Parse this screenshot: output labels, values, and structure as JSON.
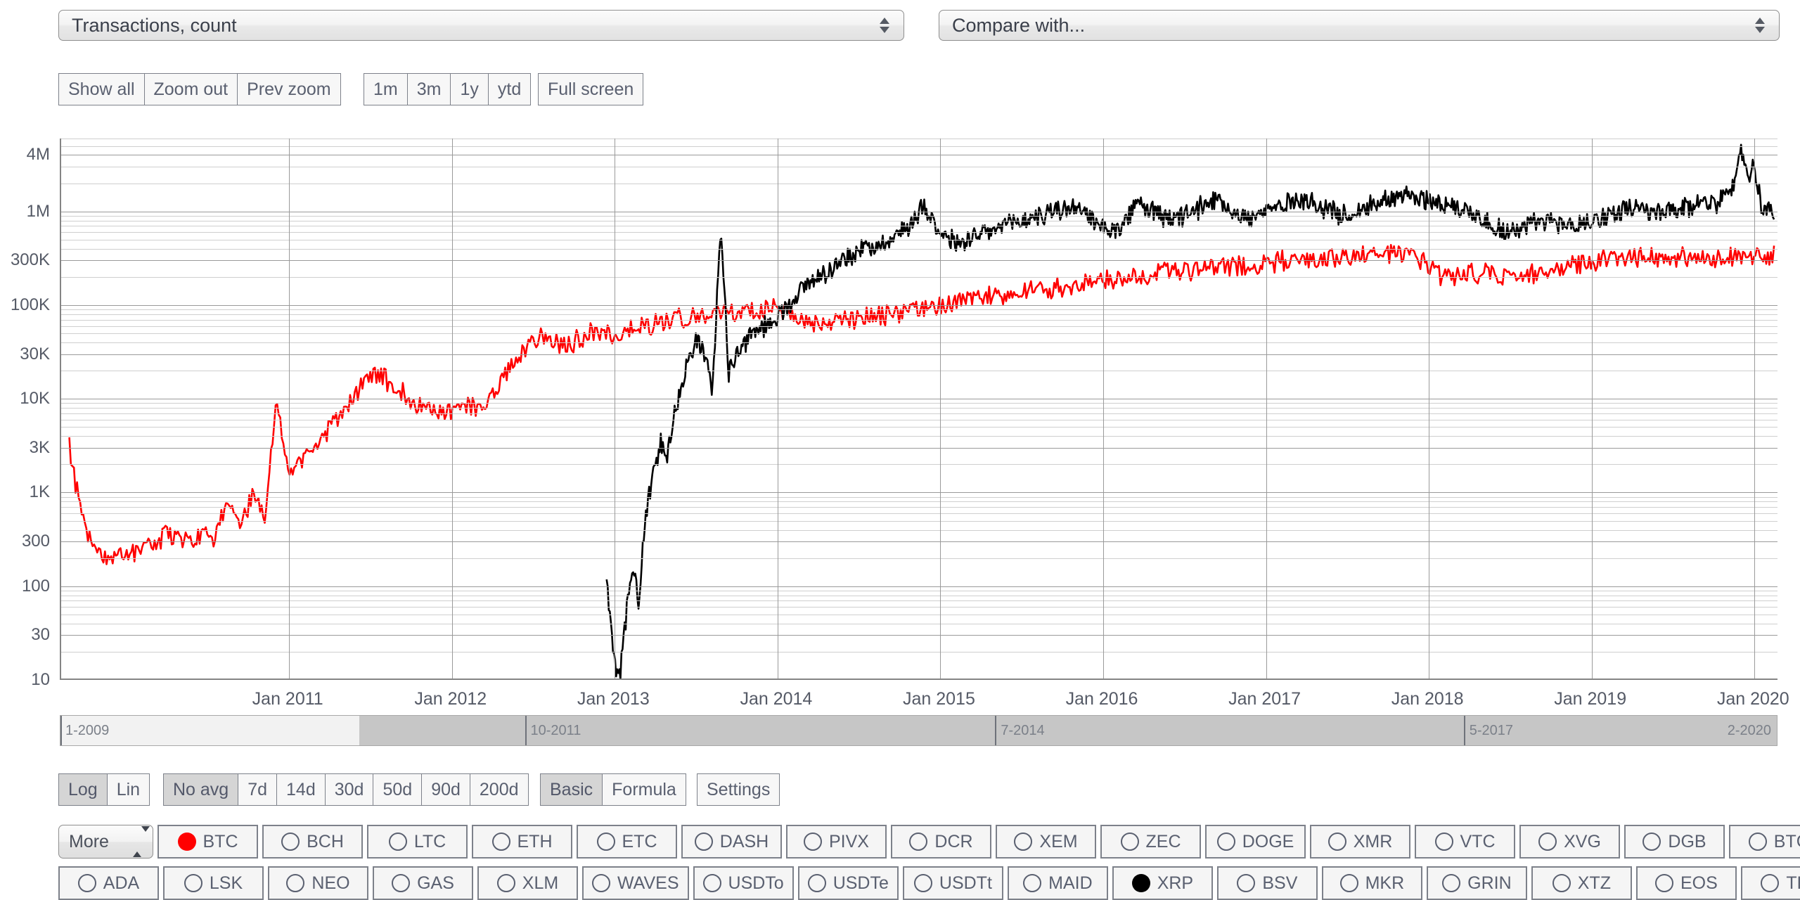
{
  "header": {
    "metric_select": {
      "value": "Transactions, count"
    },
    "compare_select": {
      "value": "Compare with..."
    }
  },
  "toolbar": {
    "zoom_nav": [
      "Show all",
      "Zoom out",
      "Prev zoom"
    ],
    "ranges": [
      "1m",
      "3m",
      "1y",
      "ytd"
    ],
    "full_screen": "Full screen"
  },
  "bottom_controls": {
    "scale": {
      "options": [
        "Log",
        "Lin"
      ],
      "active": "Log"
    },
    "average": {
      "options": [
        "No avg",
        "7d",
        "14d",
        "30d",
        "50d",
        "90d",
        "200d"
      ],
      "active": "No avg"
    },
    "mode": {
      "options": [
        "Basic",
        "Formula"
      ],
      "active": "Basic"
    },
    "settings": "Settings"
  },
  "navigator": {
    "labels": [
      "1-2009",
      "10-2011",
      "7-2014",
      "5-2017",
      "2-2020"
    ]
  },
  "coins": {
    "more_label": "More",
    "row1": [
      {
        "ticker": "BTC",
        "selected": true,
        "color": "#ff0000"
      },
      {
        "ticker": "BCH",
        "selected": false,
        "color": ""
      },
      {
        "ticker": "LTC",
        "selected": false,
        "color": ""
      },
      {
        "ticker": "ETH",
        "selected": false,
        "color": ""
      },
      {
        "ticker": "ETC",
        "selected": false,
        "color": ""
      },
      {
        "ticker": "DASH",
        "selected": false,
        "color": ""
      },
      {
        "ticker": "PIVX",
        "selected": false,
        "color": ""
      },
      {
        "ticker": "DCR",
        "selected": false,
        "color": ""
      },
      {
        "ticker": "XEM",
        "selected": false,
        "color": ""
      },
      {
        "ticker": "ZEC",
        "selected": false,
        "color": ""
      },
      {
        "ticker": "DOGE",
        "selected": false,
        "color": ""
      },
      {
        "ticker": "XMR",
        "selected": false,
        "color": ""
      },
      {
        "ticker": "VTC",
        "selected": false,
        "color": ""
      },
      {
        "ticker": "XVG",
        "selected": false,
        "color": ""
      },
      {
        "ticker": "DGB",
        "selected": false,
        "color": ""
      },
      {
        "ticker": "BTG",
        "selected": false,
        "color": ""
      }
    ],
    "row2": [
      {
        "ticker": "ADA",
        "selected": false,
        "color": ""
      },
      {
        "ticker": "LSK",
        "selected": false,
        "color": ""
      },
      {
        "ticker": "NEO",
        "selected": false,
        "color": ""
      },
      {
        "ticker": "GAS",
        "selected": false,
        "color": ""
      },
      {
        "ticker": "XLM",
        "selected": false,
        "color": ""
      },
      {
        "ticker": "WAVES",
        "selected": false,
        "color": ""
      },
      {
        "ticker": "USDTo",
        "selected": false,
        "color": ""
      },
      {
        "ticker": "USDTe",
        "selected": false,
        "color": ""
      },
      {
        "ticker": "USDTt",
        "selected": false,
        "color": ""
      },
      {
        "ticker": "MAID",
        "selected": false,
        "color": ""
      },
      {
        "ticker": "XRP",
        "selected": true,
        "color": "#000000"
      },
      {
        "ticker": "BSV",
        "selected": false,
        "color": ""
      },
      {
        "ticker": "MKR",
        "selected": false,
        "color": ""
      },
      {
        "ticker": "GRIN",
        "selected": false,
        "color": ""
      },
      {
        "ticker": "XTZ",
        "selected": false,
        "color": ""
      },
      {
        "ticker": "EOS",
        "selected": false,
        "color": ""
      },
      {
        "ticker": "TRX",
        "selected": false,
        "color": ""
      }
    ]
  },
  "chart_data": {
    "type": "line",
    "title": "Transactions, count",
    "xlabel": "",
    "ylabel": "Transactions, count",
    "yscale": "log",
    "ylim": [
      10,
      6000000
    ],
    "ytick_labels": [
      "4M",
      "1M",
      "300K",
      "100K",
      "30K",
      "10K",
      "3K",
      "1K",
      "300",
      "100",
      "30",
      "10"
    ],
    "ytick_values": [
      4000000,
      1000000,
      300000,
      100000,
      30000,
      10000,
      3000,
      1000,
      300,
      100,
      30,
      10
    ],
    "xtick_labels": [
      "Jan 2011",
      "Jan 2012",
      "Jan 2013",
      "Jan 2014",
      "Jan 2015",
      "Jan 2016",
      "Jan 2017",
      "Jan 2018",
      "Jan 2019",
      "Jan 2020"
    ],
    "xtick_values": [
      2011.0,
      2012.0,
      2013.0,
      2014.0,
      2015.0,
      2016.0,
      2017.0,
      2018.0,
      2019.0,
      2020.0
    ],
    "xlim": [
      2009.6,
      2020.15
    ],
    "grid": true,
    "legend": "none",
    "series": [
      {
        "name": "BTC",
        "color": "#ff0000",
        "x": [
          2009.65,
          2009.72,
          2009.8,
          2009.88,
          2009.95,
          2010.02,
          2010.1,
          2010.18,
          2010.25,
          2010.32,
          2010.4,
          2010.48,
          2010.55,
          2010.62,
          2010.7,
          2010.78,
          2010.85,
          2010.92,
          2011.0,
          2011.08,
          2011.15,
          2011.22,
          2011.3,
          2011.38,
          2011.45,
          2011.52,
          2011.6,
          2011.68,
          2011.75,
          2011.82,
          2011.9,
          2011.98,
          2012.05,
          2012.12,
          2012.2,
          2012.28,
          2012.35,
          2012.42,
          2012.5,
          2012.58,
          2012.65,
          2012.72,
          2012.8,
          2012.88,
          2012.95,
          2013.02,
          2013.1,
          2013.18,
          2013.25,
          2013.32,
          2013.4,
          2013.48,
          2013.55,
          2013.62,
          2013.7,
          2013.78,
          2013.85,
          2013.92,
          2014.0,
          2014.1,
          2014.2,
          2014.3,
          2014.4,
          2014.5,
          2014.6,
          2014.7,
          2014.8,
          2014.9,
          2015.0,
          2015.1,
          2015.2,
          2015.3,
          2015.4,
          2015.5,
          2015.6,
          2015.7,
          2015.8,
          2015.9,
          2016.0,
          2016.1,
          2016.2,
          2016.3,
          2016.4,
          2016.5,
          2016.6,
          2016.7,
          2016.8,
          2016.9,
          2017.0,
          2017.1,
          2017.2,
          2017.3,
          2017.4,
          2017.5,
          2017.6,
          2017.7,
          2017.8,
          2017.9,
          2018.0,
          2018.1,
          2018.2,
          2018.3,
          2018.4,
          2018.5,
          2018.6,
          2018.7,
          2018.8,
          2018.9,
          2019.0,
          2019.1,
          2019.2,
          2019.3,
          2019.4,
          2019.5,
          2019.6,
          2019.7,
          2019.8,
          2019.9,
          2020.0,
          2020.12
        ],
        "y": [
          3000,
          600,
          250,
          180,
          230,
          200,
          300,
          260,
          400,
          330,
          290,
          380,
          320,
          900,
          420,
          1100,
          520,
          9000,
          1500,
          2200,
          3000,
          4200,
          6500,
          9500,
          14000,
          19000,
          16000,
          13000,
          9000,
          8000,
          7500,
          7200,
          7800,
          8500,
          9000,
          12000,
          22000,
          30000,
          42000,
          48000,
          40000,
          38000,
          45000,
          52000,
          50000,
          46000,
          55000,
          60000,
          65000,
          68000,
          72000,
          75000,
          78000,
          80000,
          80000,
          82000,
          85000,
          88000,
          90000,
          70000,
          66000,
          64000,
          68000,
          72000,
          76000,
          80000,
          85000,
          92000,
          100000,
          110000,
          118000,
          125000,
          130000,
          135000,
          140000,
          150000,
          160000,
          170000,
          180000,
          195000,
          205000,
          215000,
          225000,
          230000,
          240000,
          250000,
          260000,
          270000,
          280000,
          290000,
          300000,
          310000,
          320000,
          330000,
          340000,
          350000,
          340000,
          330000,
          250000,
          200000,
          210000,
          220000,
          215000,
          200000,
          205000,
          230000,
          250000,
          270000,
          280000,
          300000,
          320000,
          340000,
          330000,
          320000,
          330000,
          335000,
          330000,
          325000,
          330000,
          335000
        ]
      },
      {
        "name": "XRP",
        "color": "#000000",
        "x": [
          2012.95,
          2013.0,
          2013.03,
          2013.06,
          2013.09,
          2013.12,
          2013.15,
          2013.18,
          2013.21,
          2013.25,
          2013.28,
          2013.32,
          2013.36,
          2013.4,
          2013.45,
          2013.5,
          2013.55,
          2013.6,
          2013.65,
          2013.7,
          2013.78,
          2013.85,
          2013.92,
          2014.0,
          2014.1,
          2014.2,
          2014.3,
          2014.4,
          2014.5,
          2014.6,
          2014.7,
          2014.8,
          2014.9,
          2015.0,
          2015.1,
          2015.2,
          2015.3,
          2015.4,
          2015.5,
          2015.6,
          2015.7,
          2015.8,
          2015.9,
          2016.0,
          2016.1,
          2016.2,
          2016.3,
          2016.4,
          2016.5,
          2016.6,
          2016.7,
          2016.8,
          2016.9,
          2017.0,
          2017.1,
          2017.2,
          2017.3,
          2017.4,
          2017.5,
          2017.6,
          2017.7,
          2017.8,
          2017.9,
          2018.0,
          2018.1,
          2018.2,
          2018.3,
          2018.4,
          2018.5,
          2018.6,
          2018.7,
          2018.8,
          2018.9,
          2019.0,
          2019.1,
          2019.2,
          2019.3,
          2019.4,
          2019.5,
          2019.6,
          2019.7,
          2019.78,
          2019.84,
          2019.88,
          2019.92,
          2019.96,
          2020.0,
          2020.04,
          2020.08,
          2020.12
        ],
        "y": [
          110,
          14,
          11,
          35,
          95,
          140,
          60,
          400,
          900,
          1800,
          3500,
          2500,
          6000,
          12000,
          25000,
          45000,
          30000,
          12000,
          700000,
          20000,
          35000,
          50000,
          60000,
          75000,
          120000,
          180000,
          230000,
          300000,
          380000,
          450000,
          500000,
          700000,
          1200000,
          600000,
          450000,
          520000,
          600000,
          700000,
          800000,
          900000,
          1000000,
          1100000,
          900000,
          700000,
          600000,
          1200000,
          1000000,
          800000,
          900000,
          1100000,
          1400000,
          1000000,
          800000,
          1000000,
          1200000,
          1400000,
          1200000,
          1000000,
          900000,
          1100000,
          1300000,
          1500000,
          1400000,
          1300000,
          1200000,
          1100000,
          900000,
          700000,
          600000,
          700000,
          800000,
          750000,
          700000,
          800000,
          900000,
          1100000,
          1000000,
          950000,
          1000000,
          1100000,
          1300000,
          1200000,
          2000000,
          1800000,
          4500000,
          2500000,
          3000000,
          1200000,
          1000000,
          950000
        ]
      }
    ]
  }
}
